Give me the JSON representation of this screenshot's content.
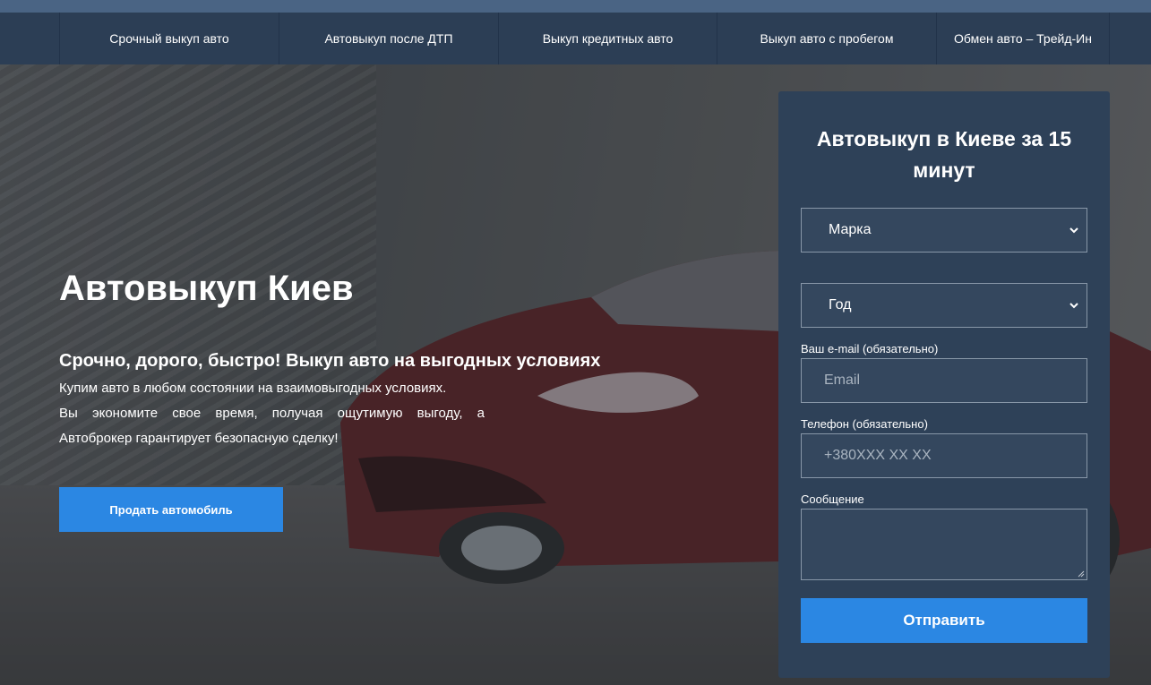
{
  "nav": {
    "items": [
      {
        "label": "Срочный выкуп авто"
      },
      {
        "label": "Автовыкуп после ДТП"
      },
      {
        "label": "Выкуп кредитных авто"
      },
      {
        "label": "Выкуп авто с пробегом"
      },
      {
        "label": "Обмен авто – Трейд-Ин"
      }
    ]
  },
  "hero": {
    "title": "Автовыкуп Киев",
    "subtitle": "Срочно, дорого, быстро! Выкуп авто на выгодных условиях",
    "text_line1": "Купим авто в любом состоянии на взаимовыгодных условиях.",
    "text_line2": "Вы экономите свое время, получая ощутимую выгоду, а Автоброкер гарантирует безопасную сделку!",
    "cta_label": "Продать автомобиль"
  },
  "form": {
    "title": "Автовыкуп в Киеве за 15 минут",
    "brand_select": "Марка",
    "year_select": "Год",
    "email_label": "Ваш e-mail (обязательно)",
    "email_placeholder": "Email",
    "phone_label": "Телефон (обязательно)",
    "phone_placeholder": "+380XXX XX XX",
    "message_label": "Сообщение",
    "submit_label": "Отправить"
  },
  "colors": {
    "nav_bg": "#2c3e55",
    "form_bg": "#2e4158",
    "accent": "#2b87e3"
  }
}
